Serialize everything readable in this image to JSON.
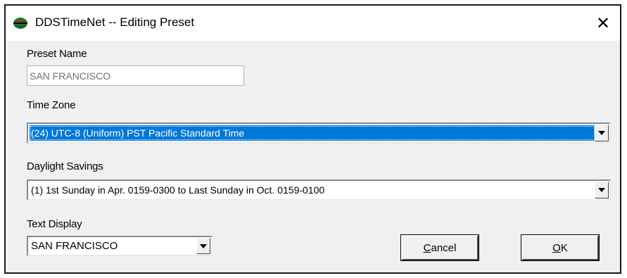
{
  "window": {
    "title": "DDSTimeNet -- Editing Preset",
    "close_glyph": "✕"
  },
  "preset_name": {
    "label": "Preset Name",
    "value": "SAN FRANCISCO"
  },
  "time_zone": {
    "label": "Time Zone",
    "selected": "(24) UTC-8 (Uniform) PST Pacific Standard Time"
  },
  "daylight_savings": {
    "label": "Daylight Savings",
    "selected": "(1) 1st Sunday in Apr. 0159-0300 to Last Sunday in Oct. 0159-0100"
  },
  "text_display": {
    "label": "Text Display",
    "selected": "SAN FRANCISCO"
  },
  "buttons": {
    "cancel_mnemonic": "C",
    "cancel_rest": "ancel",
    "ok_mnemonic": "O",
    "ok_rest": "K"
  },
  "icons": {
    "app": "globe-icon",
    "close": "close-icon",
    "dropdown": "chevron-down-icon"
  },
  "colors": {
    "selection": "#0078d7",
    "face": "#f0f0f0"
  }
}
